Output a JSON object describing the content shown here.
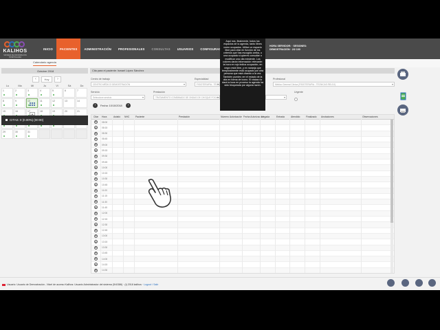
{
  "app": {
    "logo_text": "KALIHOS",
    "logo_sub": "SISTEMA DE INFORMACIÓN HOSPITALARIA",
    "logo_colors": [
      "#e8612c",
      "#2a6fbf",
      "#4caf50",
      "#8a4fb5"
    ]
  },
  "nav": {
    "items": [
      {
        "label": "INICIO"
      },
      {
        "label": "PACIENTES",
        "active": true
      },
      {
        "label": "ADMINISTRACIÓN"
      },
      {
        "label": "PROFESIONALES"
      },
      {
        "label": "CONSULTAS",
        "dim": true
      },
      {
        "label": "USUARIOS"
      },
      {
        "label": "CONFIGURACIÓN"
      }
    ],
    "accent": "#e8612c"
  },
  "user": {
    "line1": "HORA SERVIDOR: · SESIONES:",
    "line2": "DEMOSTRACIÓN · 2/2 100"
  },
  "breadcrumb": "Calendario agenda",
  "left": {
    "month_label": "Octubre 2018",
    "today_label": "Hoy",
    "prev": "‹",
    "next": "›",
    "weekdays": [
      "Lu",
      "Ma",
      "Mi",
      "Ju",
      "Vi",
      "Sá",
      "Do"
    ],
    "weeks": [
      [
        "1",
        "2",
        "3",
        "4",
        "5",
        "6",
        "7"
      ],
      [
        "8",
        "9",
        "10",
        "11",
        "12",
        "13",
        "14"
      ],
      [
        "15",
        "16",
        "17",
        "18",
        "19",
        "20",
        "21"
      ],
      [
        "22",
        "23",
        "24",
        "25",
        "26",
        "27",
        "28"
      ],
      [
        "29",
        "30",
        "31",
        "",
        "",
        "",
        ""
      ]
    ],
    "today": "10",
    "toggle": "▴",
    "citas": "CITAS: 0 (0.00%) (00:00)"
  },
  "filters": {
    "patient_bar": "Cita para el paciente: Ismael López Sánchez",
    "centro_label": "Centro de trabajo",
    "centro_value": "CENTRO MÉDICO DEMOSTRACIÓN",
    "especialidad_label": "Especialidad",
    "especialidad_value": "FISIOTERAPIA - TÉCNICAS",
    "profesional_label": "Profesional",
    "profesional_value": "Médico General Clínica (FISIOTERAPIA - TÉCNICAS RELOJ)",
    "servicio_label": "Servicio",
    "servicio_value": "Seleccione servicio",
    "prestacion_label": "Prestación",
    "prestacion_value": "TRATAMIENTO COMBINADO DE ONDAS DE CHOQUE FOCALIZADA",
    "urgente_label": "Urgente",
    "fecha_label": "Fecha: 10/10/2018"
  },
  "table": {
    "columns": [
      "Citar",
      "Hora",
      "Asistió",
      "NHC",
      "Paciente",
      "Prestación",
      "Número Autorización",
      "Fecha Autorización",
      "Llegada",
      "Entrada",
      "Atendido",
      "Finalizado",
      "Anotaciones",
      "Observaciones"
    ],
    "times": [
      "08:00",
      "08:15",
      "08:30",
      "08:45",
      "09:00",
      "09:15",
      "09:30",
      "09:45",
      "10:00",
      "10:15",
      "10:30",
      "10:45",
      "11:00",
      "11:15",
      "11:30",
      "11:45",
      "12:00",
      "12:15",
      "12:30",
      "12:45",
      "13:00",
      "13:15",
      "13:30",
      "13:45",
      "14:00",
      "14:15",
      "14:30"
    ]
  },
  "tooltip": "Aquí nos, finalmente, todos los espacios de la agenda, tanto libres como ocupados. Utilice un espacio libre para citar en función de los criterios que has escogido arriba, o una ocupada si quieres consultar o modificar una cita existente. Los colores darán información relevante: la hora en rojo indica ocupación, en negro está libre, y en naranja que temporalmente está ocupado por otra persona que está citando a la vez. También puedes ver el estado de la cita en forma de icono. El vistazo lo dará la hora en proceso la agenda ha sido bloqueada por alguna razón.",
  "footer": {
    "text": "Usuario: Usuario de Demostración - Nivel de acceso Kalihos: Usuario Administrador del sistema (5/4/386) · (t) 2018 kalihos · ",
    "logout": "Logout / Salir"
  }
}
